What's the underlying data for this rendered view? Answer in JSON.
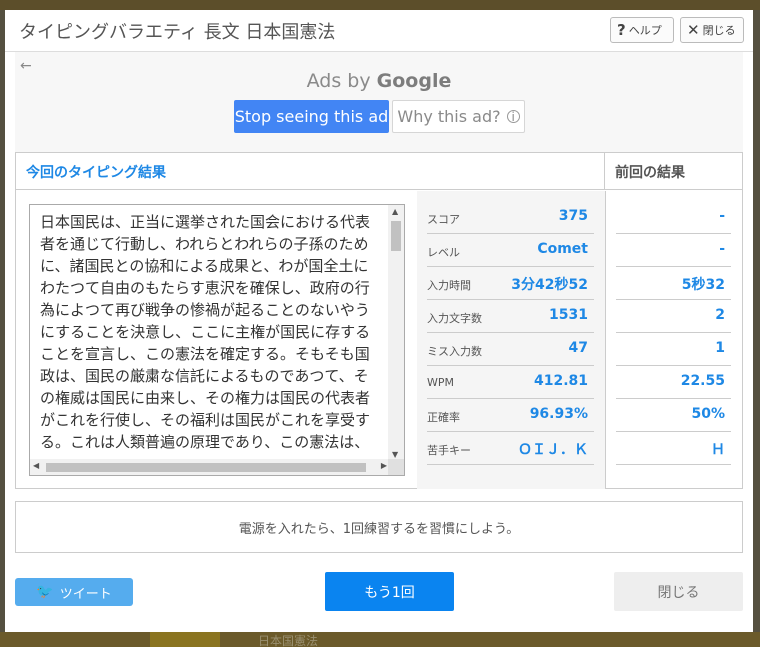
{
  "backdrop": {
    "bg_text": "日本国憲法"
  },
  "header": {
    "title": "タイピングバラエティ 長文 日本国憲法",
    "help_label": "ヘルプ",
    "close_label": "閉じる"
  },
  "ad": {
    "back_arrow": "←",
    "ads_by": "Ads by",
    "brand": "Google",
    "stop_label": "Stop seeing this ad",
    "why_label": "Why this ad?",
    "info_icon": "i"
  },
  "results": {
    "current_heading": "今回のタイピング結果",
    "previous_heading": "前回の結果",
    "typed_text": "日本国民は、正当に選挙された国会における代表\n者を通じて行動し、われらとわれらの子孫のため\nに、諸国民との協和による成果と、わが国全土に\nわたつて自由のもたらす恵沢を確保し、政府の行\n為によつて再び戦争の惨禍が起ることのないやう\nにすることを決意し、ここに主権が国民に存する\nことを宣言し、この憲法を確定する。そもそも国\n政は、国民の厳粛な信託によるものであつて、そ\nの権威は国民に由来し、その権力は国民の代表者\nがこれを行使し、その福利は国民がこれを享受す\nる。これは人類普遍の原理であり、この憲法は、",
    "stats": [
      {
        "label": "スコア",
        "current": "375",
        "previous": "-"
      },
      {
        "label": "レベル",
        "current": "Comet",
        "previous": "-"
      },
      {
        "label": "入力時間",
        "current": "3分42秒52",
        "previous": "5秒32"
      },
      {
        "label": "入力文字数",
        "current": "1531",
        "previous": "2"
      },
      {
        "label": "ミス入力数",
        "current": "47",
        "previous": "1"
      },
      {
        "label": "WPM",
        "current": "412.81",
        "previous": "22.55"
      },
      {
        "label": "正確率",
        "current": "96.93%",
        "previous": "50%"
      },
      {
        "label": "苦手キー",
        "current": "ＯＩＪ．Ｋ",
        "previous": "Ｈ"
      }
    ]
  },
  "message": "電源を入れたら、1回練習するを習慣にしよう。",
  "footer": {
    "tweet_label": "ツイート",
    "again_label": "もう1回",
    "close_label": "閉じる"
  },
  "colors": {
    "accent": "#1e88e5",
    "tweet": "#55acee",
    "again": "#0a84f0",
    "ad_button": "#4285f4"
  }
}
